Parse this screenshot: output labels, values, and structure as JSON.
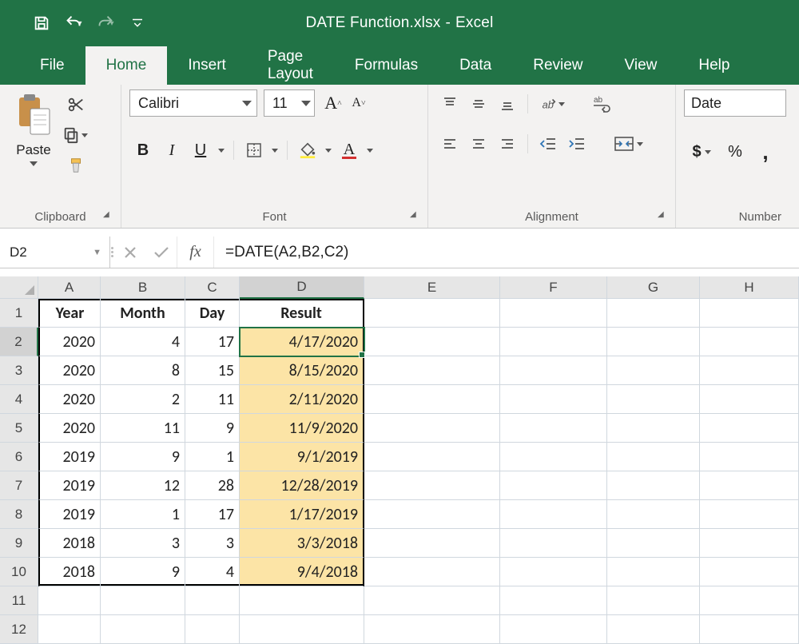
{
  "title": {
    "filename": "DATE Function.xlsx",
    "app": "Excel"
  },
  "tabs": [
    "File",
    "Home",
    "Insert",
    "Page Layout",
    "Formulas",
    "Data",
    "Review",
    "View",
    "Help"
  ],
  "active_tab": "Home",
  "ribbon": {
    "clipboard": {
      "paste": "Paste",
      "group": "Clipboard"
    },
    "font": {
      "name": "Calibri",
      "size": "11",
      "bold": "B",
      "italic": "I",
      "underline": "U",
      "group": "Font"
    },
    "alignment": {
      "group": "Alignment"
    },
    "number": {
      "format": "Date",
      "currency": "$",
      "percent": "%",
      "comma": ",",
      "group": "Number"
    }
  },
  "formula_bar": {
    "name_box": "D2",
    "fx": "fx",
    "formula": "=DATE(A2,B2,C2)"
  },
  "columns": [
    "A",
    "B",
    "C",
    "D",
    "E",
    "F",
    "G",
    "H"
  ],
  "active_cell": {
    "row": 2,
    "col": "D"
  },
  "headers": {
    "A": "Year",
    "B": "Month",
    "C": "Day",
    "D": "Result"
  },
  "rows": [
    {
      "A": "2020",
      "B": "4",
      "C": "17",
      "D": "4/17/2020"
    },
    {
      "A": "2020",
      "B": "8",
      "C": "15",
      "D": "8/15/2020"
    },
    {
      "A": "2020",
      "B": "2",
      "C": "11",
      "D": "2/11/2020"
    },
    {
      "A": "2020",
      "B": "11",
      "C": "9",
      "D": "11/9/2020"
    },
    {
      "A": "2019",
      "B": "9",
      "C": "1",
      "D": "9/1/2019"
    },
    {
      "A": "2019",
      "B": "12",
      "C": "28",
      "D": "12/28/2019"
    },
    {
      "A": "2019",
      "B": "1",
      "C": "17",
      "D": "1/17/2019"
    },
    {
      "A": "2018",
      "B": "3",
      "C": "3",
      "D": "3/3/2018"
    },
    {
      "A": "2018",
      "B": "9",
      "C": "4",
      "D": "9/4/2018"
    }
  ],
  "total_rows": 12
}
